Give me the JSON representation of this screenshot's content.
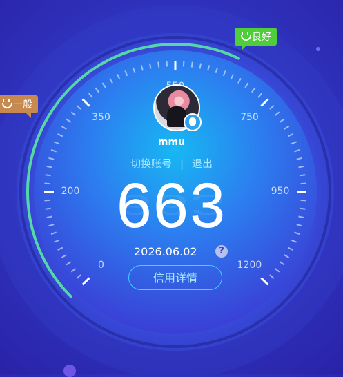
{
  "user": {
    "name": "mmu"
  },
  "account": {
    "switch_label": "切换账号",
    "separator": "|",
    "logout_label": "退出"
  },
  "score": {
    "value": "663",
    "date": "2026.06.02",
    "help": "?"
  },
  "detail_button": "信用详情",
  "tags": {
    "good": "良好",
    "normal": "一般"
  },
  "scale": {
    "min": 0,
    "max": 1200,
    "labels": [
      "0",
      "200",
      "350",
      "550",
      "750",
      "950",
      "1200"
    ]
  },
  "icons": {
    "good_tag": "smile-icon",
    "normal_tag": "smile-icon",
    "avatar_badge": "qq-icon",
    "help": "help-icon"
  },
  "colors": {
    "accent": "#3fd4ff",
    "good": "#4fcd3a",
    "normal": "#c8894e",
    "progress": "#55d7a8"
  }
}
